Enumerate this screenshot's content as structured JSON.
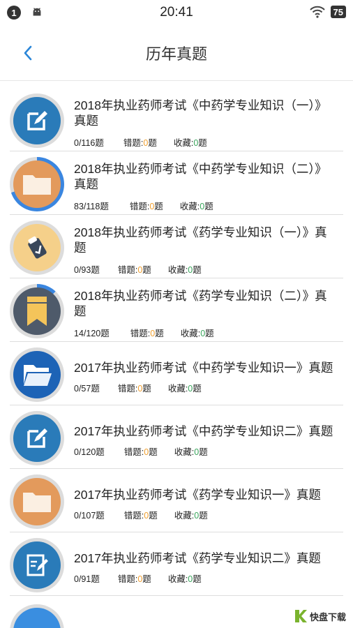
{
  "status": {
    "notification_count": "1",
    "time": "20:41",
    "battery": "75"
  },
  "header": {
    "title": "历年真题"
  },
  "labels": {
    "wrong": "错题:",
    "fav": "收藏:",
    "unit": "题",
    "unit_spaced": " 题"
  },
  "items": [
    {
      "title": "2018年执业药师考试《中药学专业知识（一）》真题",
      "progress": "0/116",
      "wrong": "0",
      "fav": "0",
      "icon": "edit-icon",
      "color": "#2a7bb9",
      "completion": 0
    },
    {
      "title": "2018年执业药师考试《中药学专业知识（二）》真题",
      "progress": "83/118",
      "wrong": "0",
      "fav": "0",
      "icon": "folder-icon",
      "color": "#e39a5c",
      "completion": 0.7
    },
    {
      "title": " 2018年执业药师考试《药学专业知识（一）》真题",
      "progress": "0/93",
      "wrong": "0",
      "fav": "0",
      "icon": "check-tag-icon",
      "color": "#f5d08a",
      "completion": 0
    },
    {
      "title": "2018年执业药师考试《药学专业知识（二）》真题",
      "progress": "14/120",
      "wrong": "0",
      "fav": "0",
      "icon": "bookmark-icon",
      "color": "#4e5a6a",
      "completion": 0.12
    },
    {
      "title": "2017年执业药师考试《中药学专业知识一》真题",
      "progress": "0/57",
      "wrong": "0",
      "fav": "0",
      "icon": "open-folder-icon",
      "color": "#1d63b6",
      "completion": 0
    },
    {
      "title": "2017年执业药师考试《中药学专业知识二》真题",
      "progress": "0/120",
      "wrong": "0",
      "fav": "0",
      "icon": "edit-icon",
      "color": "#2a7bb9",
      "completion": 0
    },
    {
      "title": "2017年执业药师考试《药学专业知识一》真题",
      "progress": "0/107",
      "wrong": "0",
      "fav": "0",
      "icon": "folder-icon",
      "color": "#e39a5c",
      "completion": 0
    },
    {
      "title": "2017年执业药师考试《药学专业知识二》真题",
      "progress": "0/91",
      "wrong": "0",
      "fav": "0",
      "icon": "document-edit-icon",
      "color": "#2a7bb9",
      "completion": 0
    }
  ],
  "watermark": {
    "text": "快盘下载"
  }
}
